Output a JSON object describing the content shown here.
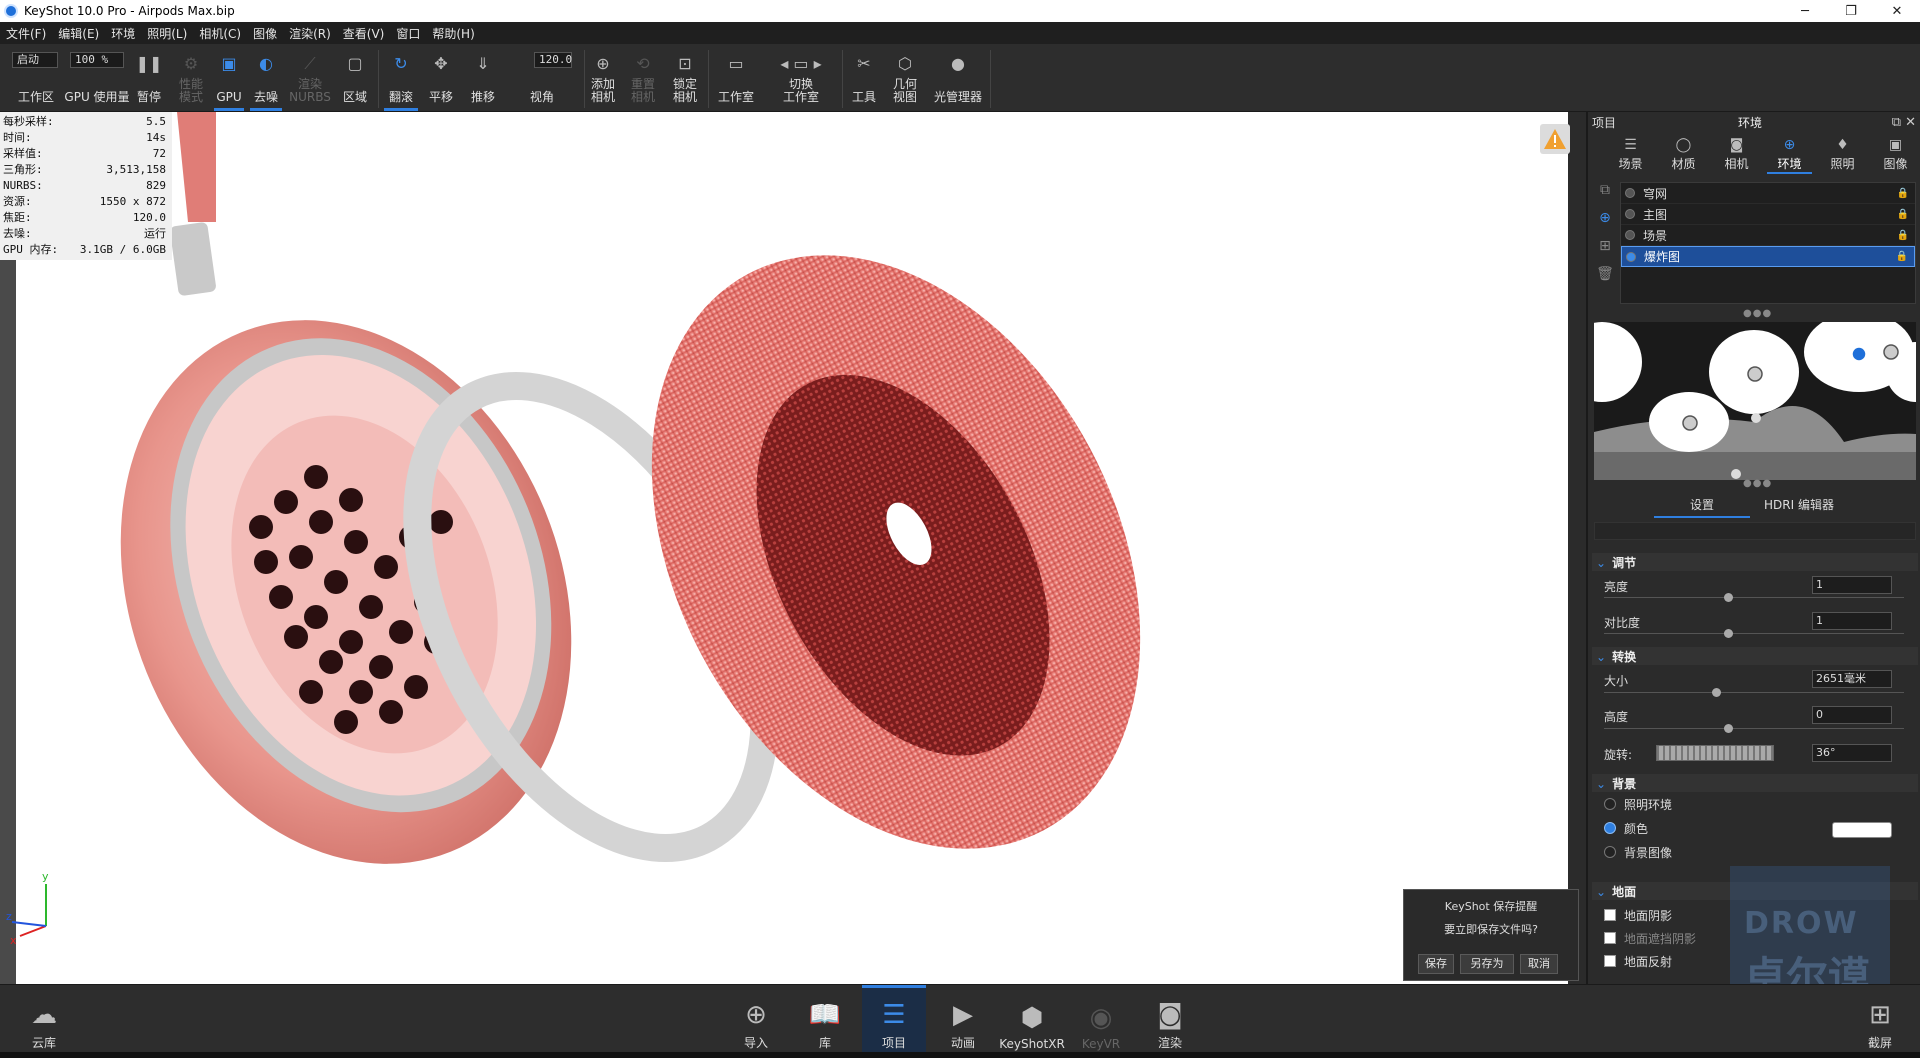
{
  "window": {
    "title": "KeyShot 10.0 Pro  -  Airpods Max.bip",
    "minimize": "─",
    "maximize": "❐",
    "close": "✕"
  },
  "menu": [
    "文件(F)",
    "编辑(E)",
    "环境",
    "照明(L)",
    "相机(C)",
    "图像",
    "渲染(R)",
    "查看(V)",
    "窗口",
    "帮助(H)"
  ],
  "toolbar": {
    "workspace_combo": "启动",
    "gpu_combo": "100 %",
    "fov_value": "120.0",
    "items": {
      "workspace": "工作区",
      "gpu_usage": "GPU 使用量",
      "pause": "暂停",
      "perf_mode": "性能\n模式",
      "gpu": "GPU",
      "denoise": "去噪",
      "render_nurbs": "渲染\nNURBS",
      "region": "区域",
      "tumble": "翻滚",
      "pan": "平移",
      "dolly": "推移",
      "fov": "视角",
      "add_camera": "添加\n相机",
      "reset_camera": "重置\n相机",
      "lock_camera": "锁定\n相机",
      "studio": "工作室",
      "switch_studio": "切换\n工作室",
      "tools": "工具",
      "geometry_view": "几何\n视图",
      "light_manager": "光管理器"
    }
  },
  "stats": [
    {
      "label": "每秒采样:",
      "value": "5.5"
    },
    {
      "label": "时间:",
      "value": "14s"
    },
    {
      "label": "采样值:",
      "value": "72"
    },
    {
      "label": "三角形:",
      "value": "3,513,158"
    },
    {
      "label": "NURBS:",
      "value": "829"
    },
    {
      "label": "资源:",
      "value": "1550 x 872"
    },
    {
      "label": "焦距:",
      "value": "120.0"
    },
    {
      "label": "去噪:",
      "value": "运行"
    },
    {
      "label": "GPU 内存:",
      "value": "3.1GB / 6.0GB"
    }
  ],
  "axes": {
    "x": "x",
    "y": "y",
    "z": "z"
  },
  "dialog": {
    "title": "KeyShot 保存提醒",
    "message": "要立即保存文件吗?",
    "save": "保存",
    "save_as": "另存为",
    "cancel": "取消"
  },
  "panel": {
    "project_label": "项目",
    "title": "环境",
    "tabs": [
      {
        "label": "场景",
        "icon": "scene-icon"
      },
      {
        "label": "材质",
        "icon": "material-icon"
      },
      {
        "label": "相机",
        "icon": "camera-icon"
      },
      {
        "label": "环境",
        "icon": "globe-icon"
      },
      {
        "label": "照明",
        "icon": "bulb-icon"
      },
      {
        "label": "图像",
        "icon": "image-icon"
      }
    ],
    "environments": [
      "穹网",
      "主图",
      "场景",
      "爆炸图"
    ],
    "subtabs": {
      "settings": "设置",
      "hdri_editor": "HDRI 编辑器"
    },
    "adjust": {
      "section": "调节",
      "brightness_label": "亮度",
      "brightness_value": "1",
      "contrast_label": "对比度",
      "contrast_value": "1"
    },
    "transform": {
      "section": "转换",
      "size_label": "大小",
      "size_value": "2651毫米",
      "height_label": "高度",
      "height_value": "0",
      "rotation_label": "旋转:",
      "rotation_value": "36°"
    },
    "background": {
      "section": "背景",
      "option_lighting": "照明环境",
      "option_color": "颜色",
      "option_image": "背景图像",
      "color_swatch": "#ffffff"
    },
    "ground": {
      "section": "地面",
      "shadow": "地面阴影",
      "occlusion": "地面遮挡阴影",
      "reflection": "地面反射"
    }
  },
  "bottom": {
    "cloud": "云库",
    "import": "导入",
    "library": "库",
    "project": "项目",
    "animation": "动画",
    "keyshotxr": "KeyShotXR",
    "keyvr": "KeyVR",
    "render": "渲染",
    "screenshot": "截屏"
  },
  "watermark": {
    "line1": "DROW",
    "line2": "卓尔谟"
  },
  "colors": {
    "accent": "#2f7fe0",
    "headphone": "#e88a86",
    "cushion": "#d9534f"
  }
}
